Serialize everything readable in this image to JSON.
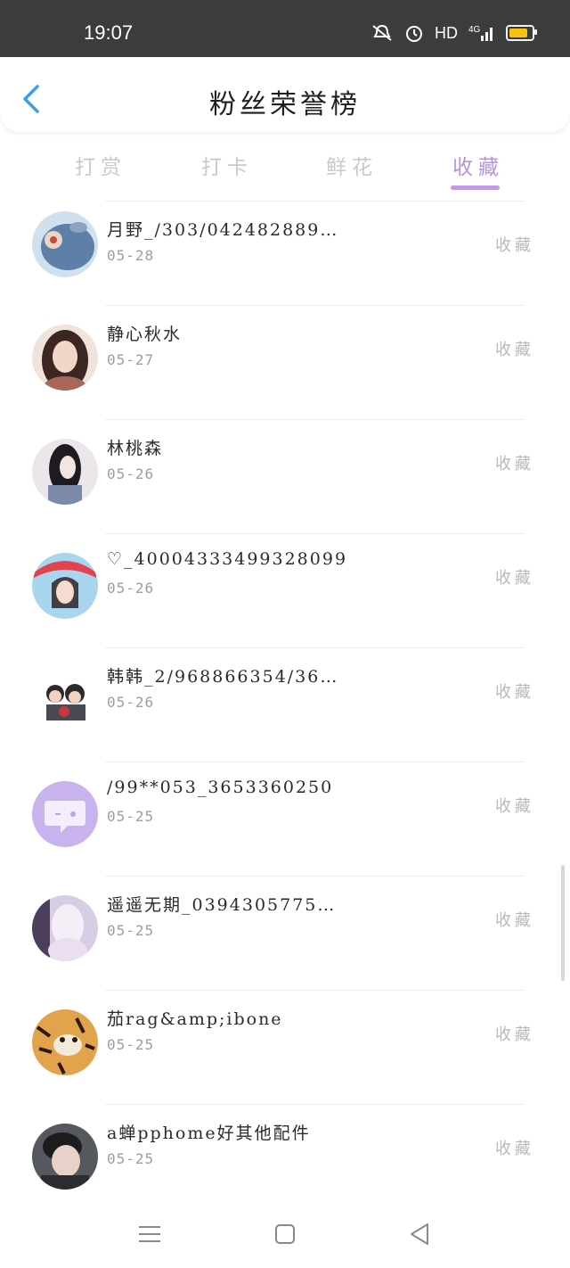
{
  "status_bar": {
    "time": "19:07",
    "network": "HD",
    "signal": "4G"
  },
  "header": {
    "title": "粉丝荣誉榜",
    "back_icon": "chevron-left-icon"
  },
  "tabs": [
    {
      "label": "打赏",
      "active": false
    },
    {
      "label": "打卡",
      "active": false
    },
    {
      "label": "鲜花",
      "active": false
    },
    {
      "label": "收藏",
      "active": true
    }
  ],
  "entries": [
    {
      "name": "月野_/303/042482889…",
      "date": "05-28",
      "action": "收藏"
    },
    {
      "name": "静心秋水",
      "date": "05-27",
      "action": "收藏"
    },
    {
      "name": "林桃森",
      "date": "05-26",
      "action": "收藏"
    },
    {
      "name": "♡_40004333499328099",
      "date": "05-26",
      "action": "收藏"
    },
    {
      "name": "韩韩_2/968866354/36…",
      "date": "05-26",
      "action": "收藏"
    },
    {
      "name": "/99**053_3653360250",
      "date": "05-25",
      "action": "收藏"
    },
    {
      "name": "遥遥无期_0394305775…",
      "date": "05-25",
      "action": "收藏"
    },
    {
      "name": "茄rag&amp;ibone",
      "date": "05-25",
      "action": "收藏"
    },
    {
      "name": "a蝉pphome好其他配件",
      "date": "05-25",
      "action": "收藏"
    }
  ],
  "colors": {
    "accent": "#b495d8",
    "underline": "#c39be4",
    "status_bar": "#3c3c3c",
    "back_arrow": "#3aa0e8"
  }
}
